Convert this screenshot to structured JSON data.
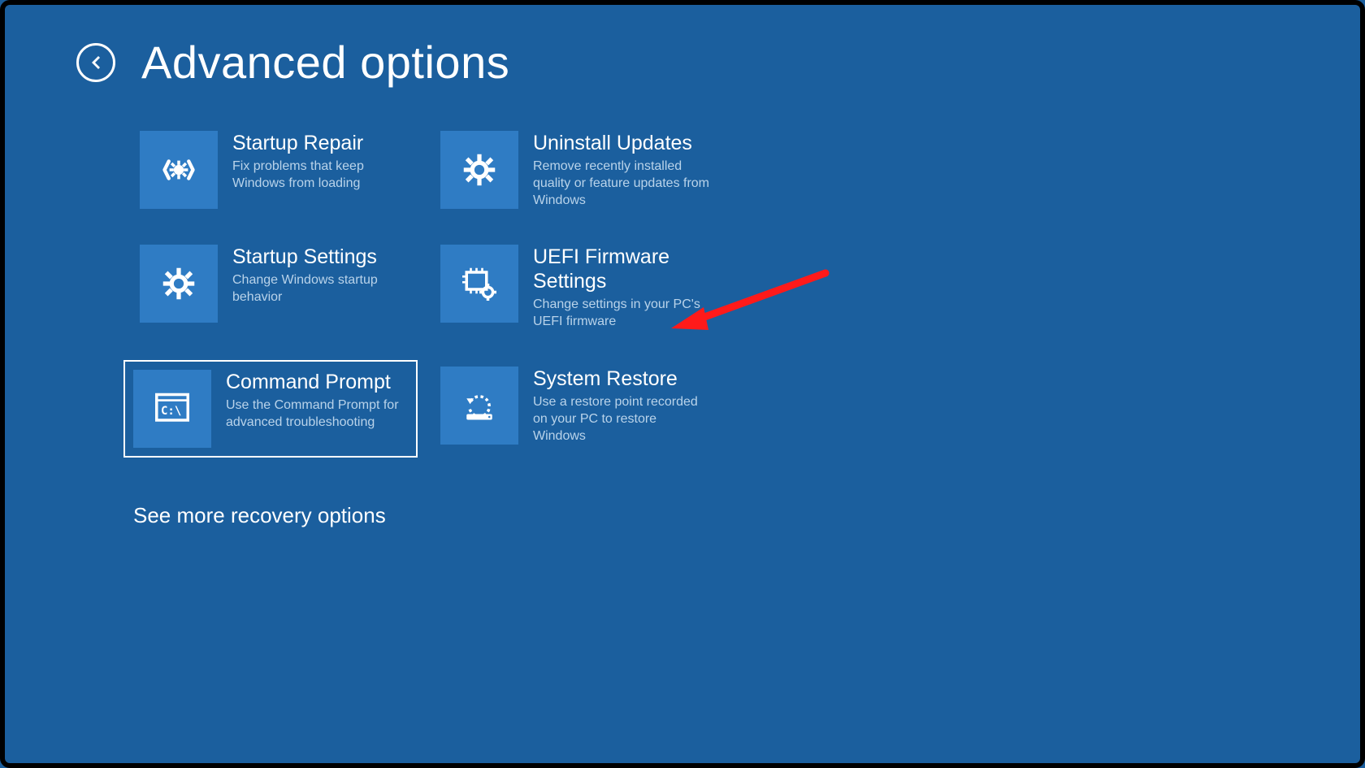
{
  "header": {
    "title": "Advanced options"
  },
  "options": {
    "startup_repair": {
      "title": "Startup Repair",
      "desc": "Fix problems that keep Windows from loading"
    },
    "uninstall_updates": {
      "title": "Uninstall Updates",
      "desc": "Remove recently installed quality or feature updates from Windows"
    },
    "startup_settings": {
      "title": "Startup Settings",
      "desc": "Change Windows startup behavior"
    },
    "uefi": {
      "title": "UEFI Firmware Settings",
      "desc": "Change settings in your PC's UEFI firmware"
    },
    "command_prompt": {
      "title": "Command Prompt",
      "desc": "Use the Command Prompt for advanced troubleshooting"
    },
    "system_restore": {
      "title": "System Restore",
      "desc": "Use a restore point recorded on your PC to restore Windows"
    }
  },
  "more_link": "See more recovery options",
  "colors": {
    "background": "#1b5f9e",
    "tile": "#2f7cc4",
    "text": "#ffffff",
    "desc": "#b9d3ea",
    "annotation_arrow": "#ff1a1a"
  }
}
